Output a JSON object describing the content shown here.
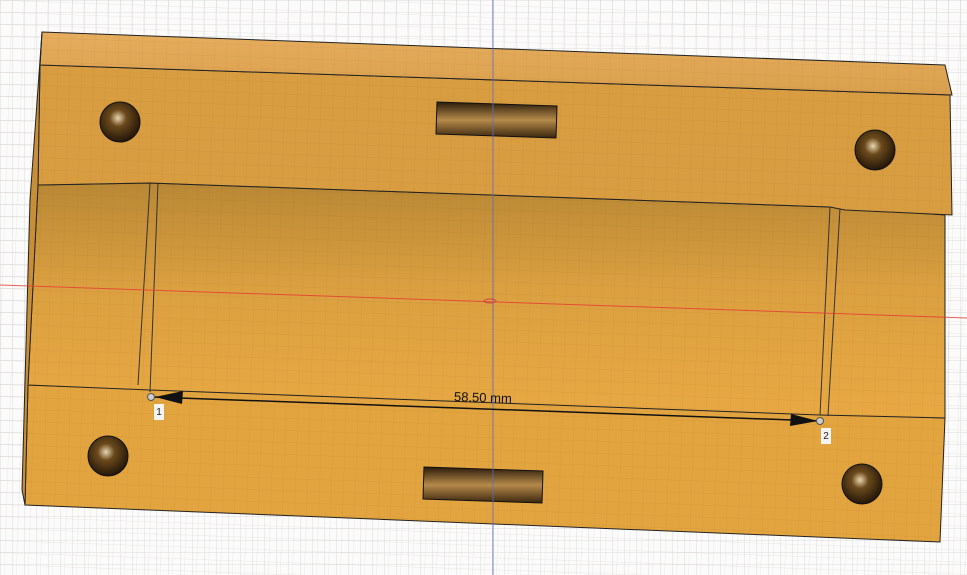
{
  "viewport": {
    "background": "#fbfbfb",
    "grid_color": "#dcdcdc",
    "body_color": "#e0a23f"
  },
  "measurement": {
    "value_label": "58.50 mm",
    "point1_label": "1",
    "point2_label": "2"
  },
  "axes": {
    "x_axis_color": "#e53935",
    "z_axis_color": "#5c6bc0"
  }
}
